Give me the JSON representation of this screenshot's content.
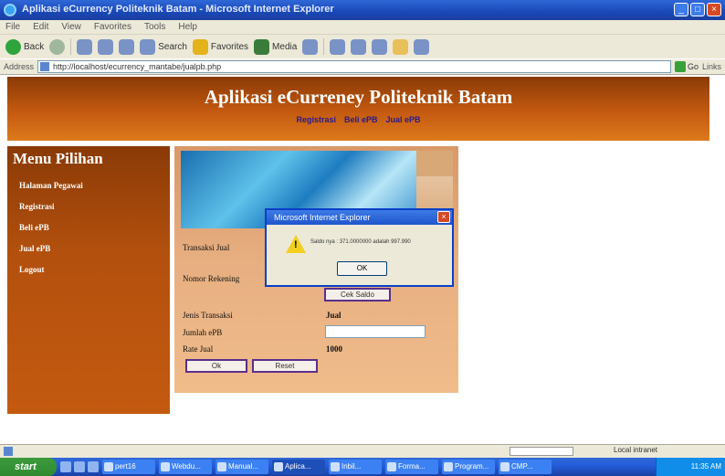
{
  "window": {
    "title": "Aplikasi eCurrency Politeknik Batam - Microsoft Internet Explorer",
    "menus": [
      "File",
      "Edit",
      "View",
      "Favorites",
      "Tools",
      "Help"
    ]
  },
  "toolbar": {
    "back_label": "Back",
    "search_label": "Search",
    "favorites_label": "Favorites",
    "media_label": "Media"
  },
  "address": {
    "label": "Address",
    "url": "http://localhost/ecurrency_mantabe/jualpb.php",
    "go_label": "Go",
    "links_label": "Links"
  },
  "page": {
    "title": "Aplikasi eCurreney Politeknik Batam",
    "nav": [
      "Registrasi",
      "Beli ePB",
      "Jual ePB"
    ]
  },
  "sidebar": {
    "title": "Menu Pilihan",
    "items": [
      "Halaman Pegawai",
      "Registrasi",
      "Beli ePB",
      "Jual ePB",
      "Logout"
    ]
  },
  "form": {
    "transaksi_label": "Transaksi Jual",
    "rekening_label": "Nomor Rekening",
    "cek_saldo_label": "Cek Saldo",
    "jenis_label": "Jenis Transaksi",
    "jenis_value": "Jual",
    "jumlah_label": "Jumlah ePB",
    "jumlah_value": "",
    "rate_label": "Rate Jual",
    "rate_value": "1000",
    "ok_label": "Ok",
    "reset_label": "Reset"
  },
  "dialog": {
    "title": "Microsoft Internet Explorer",
    "message": "Saldo nya : 371.0000000 adalah 997.990",
    "ok_label": "OK"
  },
  "statusbar": {
    "zone": "Local intranet"
  },
  "taskbar": {
    "start_label": "start",
    "tasks": [
      "pert16",
      "Webdu...",
      "Manual...",
      "Aplica...",
      "Inbil...",
      "Forma...",
      "Program...",
      "CMP..."
    ],
    "clock": "11:35 AM"
  }
}
